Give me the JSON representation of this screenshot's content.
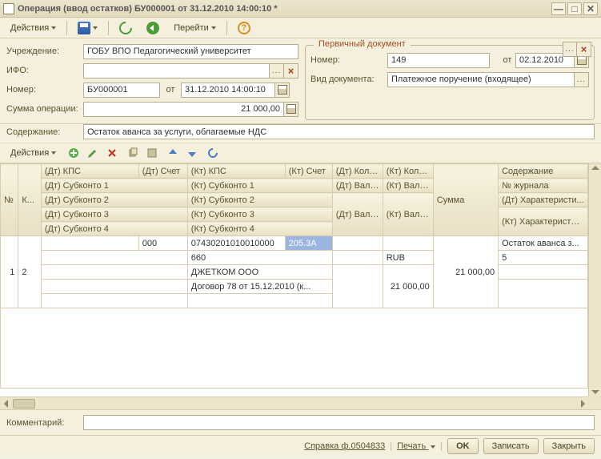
{
  "window": {
    "title": "Операция (ввод остатков) БУ000001 от 31.12.2010 14:00:10 *"
  },
  "toolbar": {
    "actions": "Действия",
    "go": "Перейти"
  },
  "form": {
    "org_label": "Учреждение:",
    "org_value": "ГОБУ ВПО Педагогический университет",
    "ifo_label": "ИФО:",
    "ifo_value": "",
    "num_label": "Номер:",
    "num_value": "БУ000001",
    "from_label": "от",
    "date_value": "31.12.2010 14:00:10",
    "sum_label": "Сумма операции:",
    "sum_value": "21 000,00",
    "content_label": "Содержание:",
    "content_value": "Остаток аванса за услуги, облагаемые НДС"
  },
  "primary_doc": {
    "title": "Первичный документ",
    "num_label": "Номер:",
    "num_value": "149",
    "from_label": "от",
    "date_value": "02.12.2010",
    "kind_label": "Вид документа:",
    "kind_value": "Платежное поручение (входящее)"
  },
  "grid_toolbar": {
    "actions": "Действия"
  },
  "grid": {
    "headers": {
      "n": "№",
      "k": "К...",
      "dt_kps": "(Дт) КПС",
      "dt_schet": "(Дт) Счет",
      "kt_kps": "(Кт) КПС",
      "kt_schet": "(Кт) Счет",
      "dt_kol": "(Дт) Коли...",
      "kt_kol": "(Кт) Колич...",
      "summa": "Сумма",
      "soderzh": "Содержание",
      "dt_sub1": "(Дт) Субконто 1",
      "kt_sub1": "(Кт) Субконто 1",
      "dt_val": "(Дт) Валю...",
      "kt_val": "(Кт) Валюта",
      "n_zh": "№ журнала",
      "dt_sub2": "(Дт) Субконто 2",
      "kt_sub2": "(Кт) Субконто 2",
      "dt_vs": "(Дт) Вал. сумма",
      "kt_vs": "(Кт) Вал. сумма",
      "dt_har": "(Дт) Характеристи...",
      "dt_sub3": "(Дт) Субконто 3",
      "kt_sub3": "(Кт) Субконто 3",
      "kt_har": "(Кт) Характеристики движения",
      "dt_sub4": "(Дт) Субконто 4",
      "kt_sub4": "(Кт) Субконто 4"
    },
    "row": {
      "n": "1",
      "k": "2",
      "dt_schet": "000",
      "kt_kps": "07430201010010000",
      "kt_schet": "205.3А",
      "summa": "21 000,00",
      "soderzh": "Остаток аванса з...",
      "kt_sub1": "660",
      "kt_val": "RUB",
      "n_zh": "5",
      "kt_sub2": "ДЖЕТКОМ ООО",
      "kt_vs": "21 000,00",
      "kt_sub3": "Договор 78 от 15.12.2010 (к..."
    }
  },
  "comment": {
    "label": "Комментарий:",
    "value": ""
  },
  "footer": {
    "spravka": "Справка ф.0504833",
    "print": "Печать",
    "ok": "OK",
    "write": "Записать",
    "close": "Закрыть"
  }
}
